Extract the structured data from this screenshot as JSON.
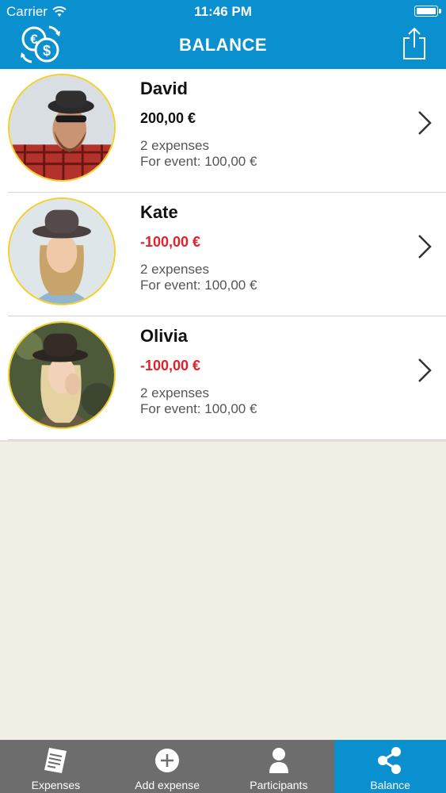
{
  "status_bar": {
    "carrier": "Carrier",
    "time": "11:46 PM"
  },
  "nav": {
    "title": "BALANCE",
    "logo_icon": "currency-exchange-icon",
    "share_icon": "share-icon"
  },
  "participants": [
    {
      "name": "David",
      "amount": "200,00 €",
      "amount_sign": "positive",
      "expenses": "2 expenses",
      "for_event": "For event: 100,00 €"
    },
    {
      "name": "Kate",
      "amount": "-100,00 €",
      "amount_sign": "negative",
      "expenses": "2 expenses",
      "for_event": "For event: 100,00 €"
    },
    {
      "name": "Olivia",
      "amount": "-100,00 €",
      "amount_sign": "negative",
      "expenses": "2 expenses",
      "for_event": "For event: 100,00 €"
    }
  ],
  "tabs": [
    {
      "label": "Expenses",
      "icon": "receipt-icon",
      "active": false
    },
    {
      "label": "Add expense",
      "icon": "plus-circle-icon",
      "active": false
    },
    {
      "label": "Participants",
      "icon": "person-icon",
      "active": false
    },
    {
      "label": "Balance",
      "icon": "share-nodes-icon",
      "active": true
    }
  ],
  "colors": {
    "primary": "#0a8fcf",
    "negative": "#e0222a",
    "avatar_ring": "#f2cf2a",
    "tabbar": "#6d6d6d",
    "background": "#f1efe4"
  }
}
